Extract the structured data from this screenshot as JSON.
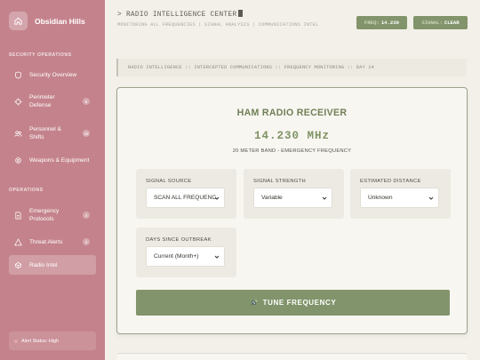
{
  "sidebar": {
    "brand": "Obsidian Hills",
    "sections": {
      "security": "SECURITY OPERATIONS",
      "operations": "OPERATIONS"
    },
    "items": [
      {
        "label": "Security Overview",
        "icon": "shield-icon"
      },
      {
        "label": "Perimeter Defense",
        "icon": "crosshair-icon",
        "badge": "6"
      },
      {
        "label": "Personnel & Shifts",
        "icon": "people-icon",
        "badge": "18"
      },
      {
        "label": "Weapons & Equipment",
        "icon": "gear-icon"
      },
      {
        "label": "Emergency Protocols",
        "icon": "document-icon",
        "badge": "4"
      },
      {
        "label": "Threat Alerts",
        "icon": "warning-icon",
        "badge": "3"
      },
      {
        "label": "Radio Intel",
        "icon": "radio-icon",
        "active": true
      }
    ],
    "alert_status": "Alert Status: High"
  },
  "header": {
    "title": "> RADIO INTELLIGENCE CENTER",
    "subtitle": "MONITORING ALL FREQUENCIES | SIGNAL ANALYSIS | COMMUNICATIONS INTEL",
    "freq_label": "FREQ:",
    "freq_value": "14.230",
    "signal_label": "SIGNAL:",
    "signal_value": "CLEAR"
  },
  "ticker": "RADIO INTELLIGENCE :: INTERCEPTED COMMUNICATIONS :: FREQUENCY MONITORING :: DAY 14",
  "receiver": {
    "title": "HAM RADIO RECEIVER",
    "frequency": "14.230 MHz",
    "band": "20 METER BAND - EMERGENCY FREQUENCY",
    "fields": {
      "signal_source": {
        "label": "SIGNAL SOURCE",
        "value": "SCAN ALL FREQUENCIES"
      },
      "signal_strength": {
        "label": "SIGNAL STRENGTH",
        "value": "Variable"
      },
      "estimated_distance": {
        "label": "ESTIMATED DISTANCE",
        "value": "Unknown"
      },
      "days_since": {
        "label": "DAYS SINCE OUTBREAK",
        "value": "Current (Month+)"
      }
    },
    "tune_button": "TUNE FREQUENCY"
  },
  "colors": {
    "sidebar": "#c4838c",
    "accent": "#82946b",
    "background": "#f3f0ea"
  }
}
